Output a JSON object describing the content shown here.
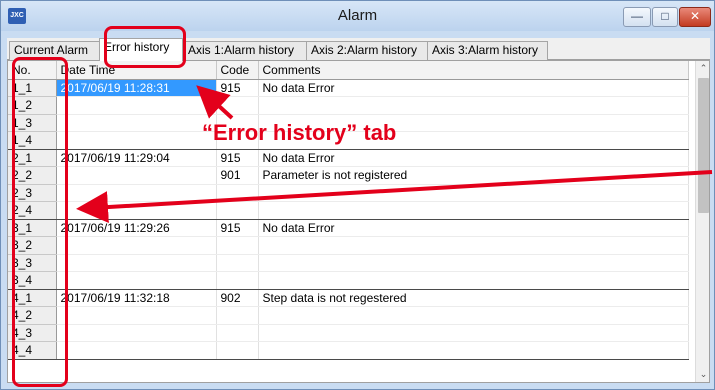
{
  "window": {
    "title": "Alarm",
    "icon_text": "JXC"
  },
  "tabs": [
    {
      "label": "Current Alarm",
      "active": false
    },
    {
      "label": "Error history",
      "active": true
    },
    {
      "label": "Axis 1:Alarm history",
      "active": false
    },
    {
      "label": "Axis 2:Alarm history",
      "active": false
    },
    {
      "label": "Axis 3:Alarm history",
      "active": false
    }
  ],
  "columns": [
    "No.",
    "Date Time",
    "Code",
    "Comments"
  ],
  "rows": [
    {
      "no": "1_1",
      "datetime": "2017/06/19 11:28:31",
      "code": "915",
      "comment": "No data Error"
    },
    {
      "no": "1_2",
      "datetime": "",
      "code": "",
      "comment": ""
    },
    {
      "no": "1_3",
      "datetime": "",
      "code": "",
      "comment": ""
    },
    {
      "no": "1_4",
      "datetime": "",
      "code": "",
      "comment": ""
    },
    {
      "no": "2_1",
      "datetime": "2017/06/19 11:29:04",
      "code": "915",
      "comment": "No data Error"
    },
    {
      "no": "2_2",
      "datetime": "",
      "code": "901",
      "comment": "Parameter is not registered"
    },
    {
      "no": "2_3",
      "datetime": "",
      "code": "",
      "comment": ""
    },
    {
      "no": "2_4",
      "datetime": "",
      "code": "",
      "comment": ""
    },
    {
      "no": "3_1",
      "datetime": "2017/06/19 11:29:26",
      "code": "915",
      "comment": "No data Error"
    },
    {
      "no": "3_2",
      "datetime": "",
      "code": "",
      "comment": ""
    },
    {
      "no": "3_3",
      "datetime": "",
      "code": "",
      "comment": ""
    },
    {
      "no": "3_4",
      "datetime": "",
      "code": "",
      "comment": ""
    },
    {
      "no": "4_1",
      "datetime": "2017/06/19 11:32:18",
      "code": "902",
      "comment": "Step data is not regestered"
    },
    {
      "no": "4_2",
      "datetime": "",
      "code": "",
      "comment": ""
    },
    {
      "no": "4_3",
      "datetime": "",
      "code": "",
      "comment": ""
    },
    {
      "no": "4_4",
      "datetime": "",
      "code": "",
      "comment": ""
    }
  ],
  "annotation": {
    "label": "“Error history” tab",
    "color": "#e3001b"
  },
  "colors": {
    "selection": "#3399ff",
    "accent_red": "#e3001b"
  }
}
